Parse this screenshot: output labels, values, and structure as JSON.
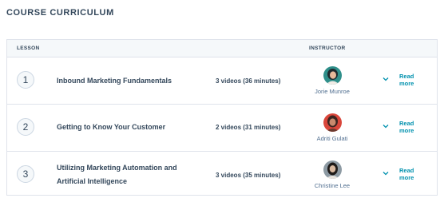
{
  "page": {
    "title": "COURSE CURRICULUM"
  },
  "table": {
    "headers": {
      "lesson": "LESSON",
      "instructor": "INSTRUCTOR"
    },
    "rows": [
      {
        "number": "1",
        "title": "Inbound Marketing Fundamentals",
        "videos": "3 videos (36 minutes)",
        "instructor": "Jorie Munroe",
        "read_more": "Read more"
      },
      {
        "number": "2",
        "title": "Getting to Know Your Customer",
        "videos": "2 videos (31 minutes)",
        "instructor": "Adriti Gulati",
        "read_more": "Read more"
      },
      {
        "number": "3",
        "title": "Utilizing Marketing Automation and Artificial Intelligence",
        "videos": "3 videos (35 minutes)",
        "instructor": "Christine Lee",
        "read_more": "Read more"
      }
    ]
  },
  "colors": {
    "text": "#33475b",
    "link": "#0091ae",
    "border": "#dfe3eb",
    "header_bg": "#f5f8fa"
  },
  "icons": {
    "expand": "chevron-down-icon"
  }
}
